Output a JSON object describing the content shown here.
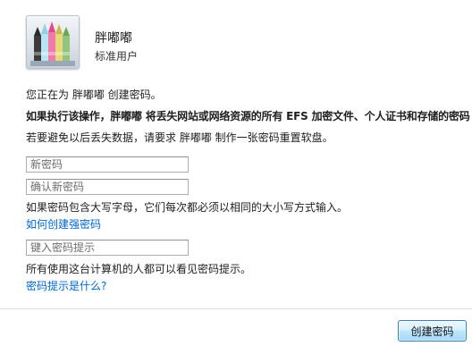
{
  "user": {
    "name": "胖嘟嘟",
    "account_type": "标准用户"
  },
  "messages": {
    "intro": "您正在为 胖嘟嘟 创建密码。",
    "warning": "如果执行该操作，胖嘟嘟 将丢失网站或网络资源的所有 EFS 加密文件、个人证书和存储的密码",
    "reset_disk_tip": "若要避免以后丢失数据，请要求 胖嘟嘟 制作一张密码重置软盘。",
    "case_note": "如果密码包含大写字母，它们每次都必须以相同的大小写方式输入。",
    "hint_note": "所有使用这台计算机的人都可以看见密码提示。"
  },
  "fields": {
    "new_password": {
      "placeholder": "新密码",
      "value": ""
    },
    "confirm_password": {
      "placeholder": "确认新密码",
      "value": ""
    },
    "password_hint": {
      "placeholder": "键入密码提示",
      "value": ""
    }
  },
  "links": {
    "strong_password": "如何创建强密码",
    "what_is_hint": "密码提示是什么?"
  },
  "buttons": {
    "create_password": "创建密码"
  },
  "colors": {
    "link": "#0066cc",
    "button_border": "#3c7fb1",
    "divider": "#dfdfdf"
  },
  "icons": {
    "avatar": "crayons-avatar-icon"
  }
}
